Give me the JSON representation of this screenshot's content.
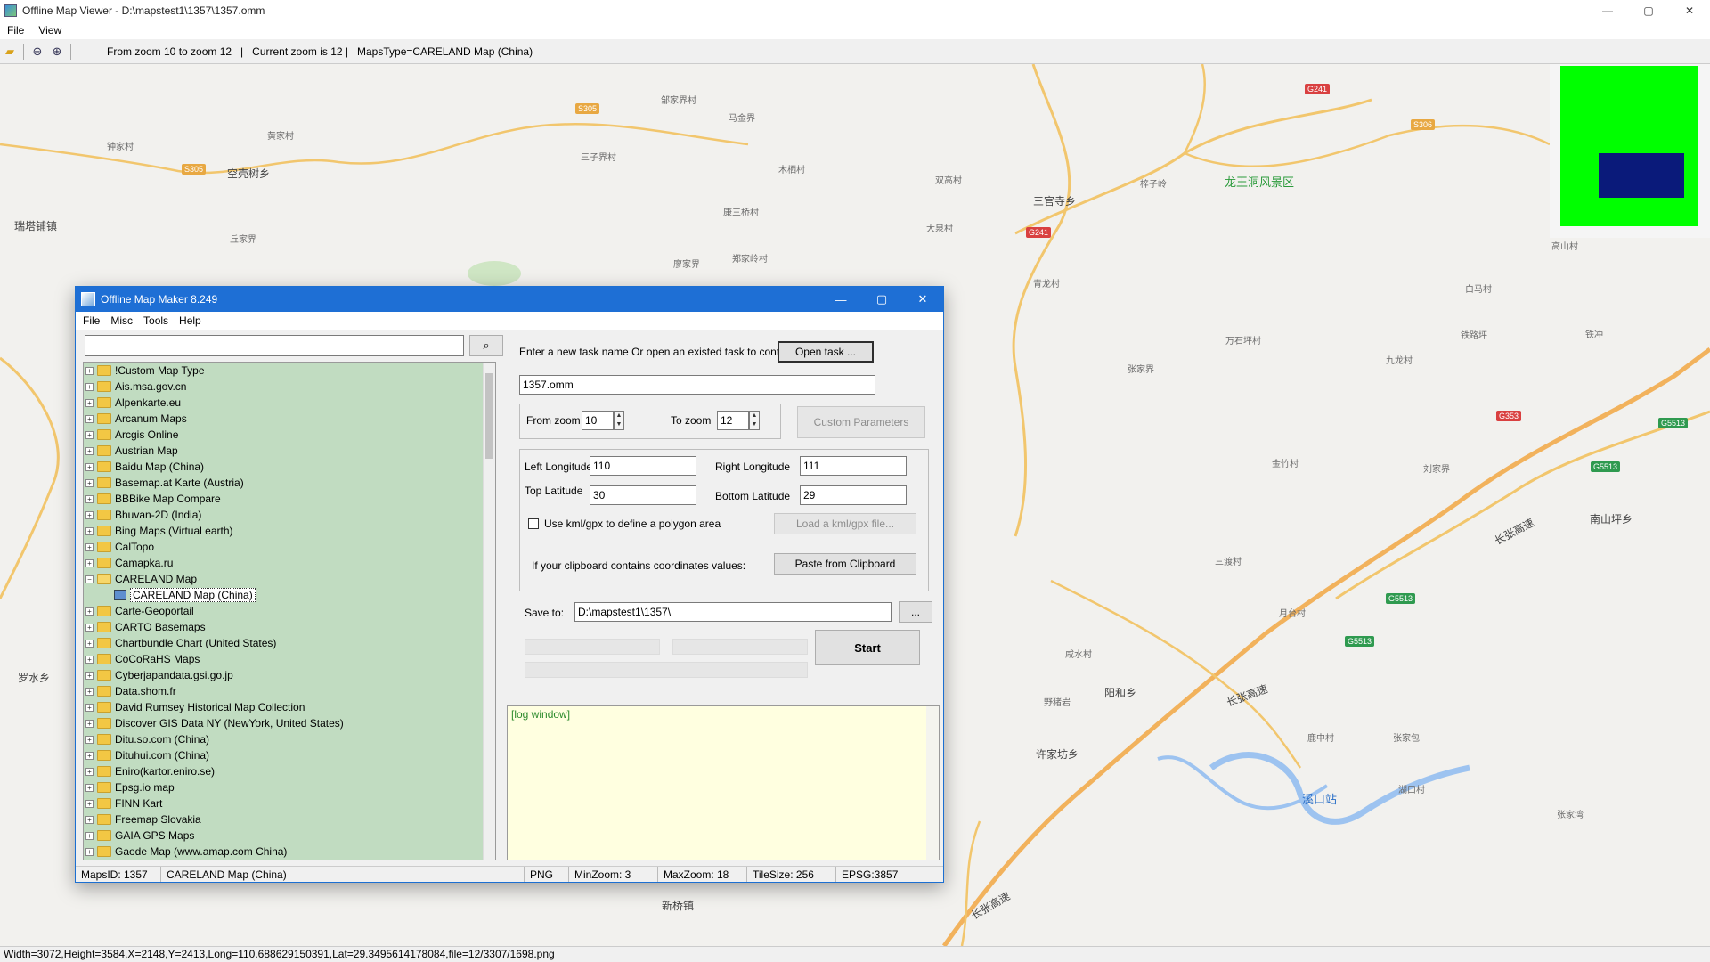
{
  "window": {
    "title": "Offline Map Viewer - D:\\mapstest1\\1357\\1357.omm",
    "controls": [
      "—",
      "▢",
      "✕"
    ]
  },
  "menu": [
    "File",
    "View"
  ],
  "toolbar": {
    "info": "From zoom 10 to zoom 12   |   Current zoom is 12 |   MapsType=CARELAND Map (China)"
  },
  "map": {
    "labels": [
      "龙王洞风景区",
      "三官寺乡",
      "瑞塔铺镇",
      "空壳树乡",
      "罗水乡",
      "阳和乡",
      "溪口站",
      "许家坊乡",
      "新桥镇",
      "南山坪乡",
      "铁冲",
      "白马村",
      "丘家界",
      "黄家村",
      "钟家村",
      "三子界村",
      "马金界",
      "木栖村",
      "邹家界村",
      "康三桥村",
      "郑家岭村",
      "廖家界",
      "大泉村",
      "双高村",
      "梓子岭",
      "青龙村",
      "张家界",
      "金竹村",
      "万石坪村",
      "九龙村",
      "刘家界",
      "三渡村",
      "月台村",
      "咸水村",
      "野猪岩",
      "鹿中村",
      "张家包",
      "湖口村",
      "高山村",
      "张家湾",
      "铁路坪"
    ],
    "roads": [
      "G241",
      "S305",
      "S306",
      "G241",
      "G353",
      "G5513",
      "G5513",
      "G5513",
      "G5513"
    ],
    "road_names": [
      "长张高速",
      "长张高速",
      "长张高速"
    ]
  },
  "status": {
    "text": "Width=3072,Height=3584,X=2148,Y=2413,Long=110.688629150391,Lat=29.3495614178084,file=12/3307/1698.png"
  },
  "dialog": {
    "title": "Offline Map Maker 8.249",
    "menu": [
      "File",
      "Misc",
      "Tools",
      "Help"
    ],
    "tree": [
      "!Custom Map Type",
      "Ais.msa.gov.cn",
      "Alpenkarte.eu",
      "Arcanum Maps",
      "Arcgis Online",
      "Austrian Map",
      "Baidu Map (China)",
      "Basemap.at Karte (Austria)",
      "BBBike Map Compare",
      "Bhuvan-2D (India)",
      "Bing Maps (Virtual earth)",
      "CalTopo",
      "Camapka.ru",
      "CARELAND Map",
      "CARELAND Map (China)",
      "Carte-Geoportail",
      "CARTO Basemaps",
      "Chartbundle Chart (United States)",
      "CoCoRaHS Maps",
      "Cyberjapandata.gsi.go.jp",
      "Data.shom.fr",
      "David Rumsey Historical Map Collection",
      "Discover GIS Data NY (NewYork, United States)",
      "Ditu.so.com (China)",
      "Dituhui.com (China)",
      "Eniro(kartor.eniro.se)",
      "Epsg.io map",
      "FINN Kart",
      "Freemap Slovakia",
      "GAIA GPS Maps",
      "Gaode Map (www.amap.com China)"
    ],
    "task_prompt": "Enter a new task name Or open an existed task to continue:",
    "open_task": "Open task ...",
    "task_name": "1357.omm",
    "from_zoom_label": "From zoom",
    "from_zoom": "10",
    "to_zoom_label": "To zoom",
    "to_zoom": "12",
    "custom_params": "Custom Parameters",
    "left_lon_label": "Left Longitude",
    "left_lon": "110",
    "right_lon_label": "Right Longitude",
    "right_lon": "111",
    "top_lat_label": "Top Latitude",
    "top_lat": "30",
    "bottom_lat_label": "Bottom Latitude",
    "bottom_lat": "29",
    "kml_label": "Use kml/gpx to define a polygon area",
    "load_kml": "Load a kml/gpx file...",
    "clipboard_label": "If your clipboard contains coordinates values:",
    "paste_clip": "Paste from Clipboard",
    "save_label": "Save to:",
    "save_path": "D:\\mapstest1\\1357\\",
    "browse": "...",
    "start": "Start",
    "log": "[log window]",
    "status": [
      "MapsID: 1357",
      "CARELAND Map (China)",
      "PNG",
      "MinZoom: 3",
      "MaxZoom: 18",
      "TileSize: 256",
      "EPSG:3857"
    ]
  }
}
